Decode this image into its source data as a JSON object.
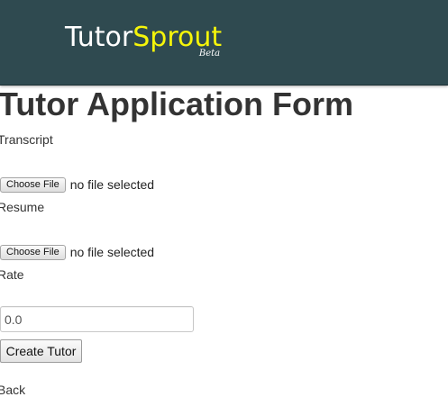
{
  "navbar": {
    "brand_part1": "Tutor",
    "brand_part2": "Sprout",
    "brand_tag": "Beta",
    "background_color": "#2f4a50",
    "accent_color": "#f5f50a"
  },
  "page": {
    "title": "Tutor Application Form"
  },
  "form": {
    "transcript": {
      "label": "Transcript",
      "button_label": "Choose File",
      "status": "no file selected"
    },
    "resume": {
      "label": "Resume",
      "button_label": "Choose File",
      "status": "no file selected"
    },
    "rate": {
      "label": "Rate",
      "value": "0.0"
    },
    "submit_label": "Create Tutor"
  },
  "footer": {
    "back_label": "Back"
  }
}
